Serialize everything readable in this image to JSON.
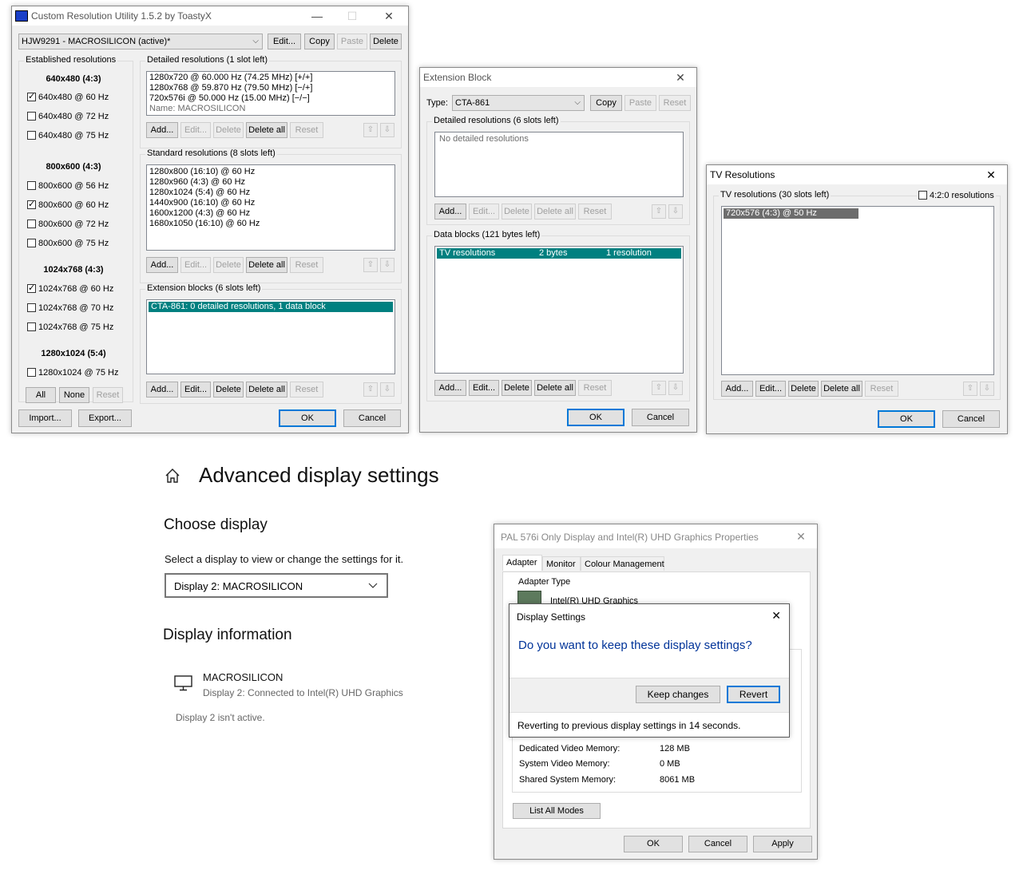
{
  "cru": {
    "title": "Custom Resolution Utility 1.5.2 by ToastyX",
    "monitor": "HJW9291 - MACROSILICON (active)*",
    "top_buttons": {
      "edit": "Edit...",
      "copy": "Copy",
      "paste": "Paste",
      "delete": "Delete"
    },
    "established": {
      "label": "Established resolutions",
      "groups": [
        {
          "heading": "640x480 (4:3)",
          "items": [
            {
              "label": "640x480 @ 60 Hz",
              "checked": true
            },
            {
              "label": "640x480 @ 72 Hz",
              "checked": false
            },
            {
              "label": "640x480 @ 75 Hz",
              "checked": false
            }
          ]
        },
        {
          "heading": "800x600 (4:3)",
          "items": [
            {
              "label": "800x600 @ 56 Hz",
              "checked": false
            },
            {
              "label": "800x600 @ 60 Hz",
              "checked": true
            },
            {
              "label": "800x600 @ 72 Hz",
              "checked": false
            },
            {
              "label": "800x600 @ 75 Hz",
              "checked": false
            }
          ]
        },
        {
          "heading": "1024x768 (4:3)",
          "items": [
            {
              "label": "1024x768 @ 60 Hz",
              "checked": true
            },
            {
              "label": "1024x768 @ 70 Hz",
              "checked": false
            },
            {
              "label": "1024x768 @ 75 Hz",
              "checked": false
            }
          ]
        },
        {
          "heading": "1280x1024 (5:4)",
          "items": [
            {
              "label": "1280x1024 @ 75 Hz",
              "checked": false
            }
          ]
        }
      ],
      "buttons": {
        "all": "All",
        "none": "None",
        "reset": "Reset"
      }
    },
    "detailed": {
      "label": "Detailed resolutions (1 slot left)",
      "items": [
        "1280x720 @ 60.000 Hz (74.25 MHz) [+/+]",
        "1280x768 @ 59.870 Hz (79.50 MHz) [−/+]",
        "720x576i @ 50.000 Hz (15.00 MHz) [−/−]"
      ],
      "name_line": "Name: MACROSILICON"
    },
    "standard": {
      "label": "Standard resolutions (8 slots left)",
      "items": [
        "1280x800 (16:10) @ 60 Hz",
        "1280x960 (4:3) @ 60 Hz",
        "1280x1024 (5:4) @ 60 Hz",
        "1440x900 (16:10) @ 60 Hz",
        "1600x1200 (4:3) @ 60 Hz",
        "1680x1050 (16:10) @ 60 Hz"
      ]
    },
    "extension": {
      "label": "Extension blocks (6 slots left)",
      "items": [
        "CTA-861: 0 detailed resolutions, 1 data block"
      ]
    },
    "list_buttons": {
      "add": "Add...",
      "edit": "Edit...",
      "delete": "Delete",
      "delete_all": "Delete all",
      "reset": "Reset"
    },
    "import": "Import...",
    "export": "Export...",
    "ok": "OK",
    "cancel": "Cancel"
  },
  "ext_block": {
    "title": "Extension Block",
    "type_label": "Type:",
    "type_value": "CTA-861",
    "copy": "Copy",
    "paste": "Paste",
    "reset": "Reset",
    "detailed_label": "Detailed resolutions (6 slots left)",
    "detailed_empty": "No detailed resolutions",
    "data_label": "Data blocks (121 bytes left)",
    "data_row": {
      "name": "TV resolutions",
      "size": "2 bytes",
      "info": "1 resolution"
    },
    "ok": "OK",
    "cancel": "Cancel"
  },
  "tv_res": {
    "title": "TV Resolutions",
    "label": "TV resolutions (30 slots left)",
    "option_420": "4:2:0 resolutions",
    "option_420_checked": false,
    "items": [
      "720x576 (4:3) @ 50 Hz"
    ],
    "ok": "OK",
    "cancel": "Cancel"
  },
  "settings": {
    "page_title": "Advanced display settings",
    "choose_heading": "Choose display",
    "choose_desc": "Select a display to view or change the settings for it.",
    "display_select": "Display 2: MACROSILICON",
    "info_heading": "Display information",
    "monitor_name": "MACROSILICON",
    "monitor_desc": "Display 2: Connected to Intel(R) UHD Graphics",
    "inactive_note": "Display 2 isn't active."
  },
  "props": {
    "title": "PAL 576i Only Display and Intel(R) UHD Graphics Properties",
    "tabs": [
      "Adapter",
      "Monitor",
      "Colour Management"
    ],
    "adapter_type_label": "Adapter Type",
    "adapter_name": "Intel(R) UHD Graphics",
    "memory": [
      {
        "label": "Dedicated Video Memory:",
        "value": "128 MB"
      },
      {
        "label": "System Video Memory:",
        "value": "0 MB"
      },
      {
        "label": "Shared System Memory:",
        "value": "8061 MB"
      }
    ],
    "list_all_modes": "List All Modes",
    "ok": "OK",
    "cancel": "Cancel",
    "apply": "Apply"
  },
  "confirm": {
    "title": "Display Settings",
    "question": "Do you want to keep these display settings?",
    "keep": "Keep changes",
    "revert": "Revert",
    "countdown": "Reverting to previous display settings in 14 seconds."
  },
  "colors": {
    "selection": "#008080",
    "accent": "#0078d7",
    "link_blue": "#003399"
  }
}
